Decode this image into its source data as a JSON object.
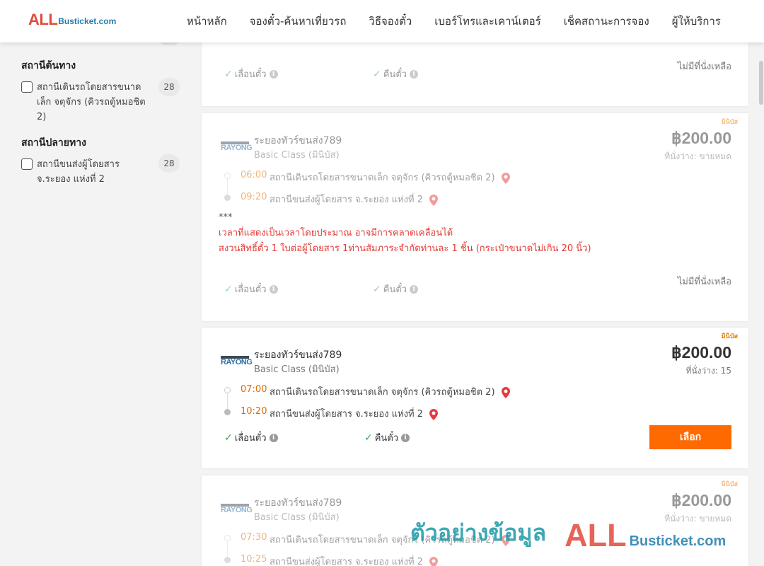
{
  "brand": {
    "logo_all": "ALL",
    "logo_rest": "Busticket.com"
  },
  "nav": [
    {
      "label": "หน้าหลัก"
    },
    {
      "label": "จองตั๋ว-ค้นหาเที่ยวรถ"
    },
    {
      "label": "วิธีจองตั๋ว"
    },
    {
      "label": "เบอร์โทรและเคาน์เตอร์"
    },
    {
      "label": "เช็คสถานะการจอง"
    },
    {
      "label": "ผู้ให้บริการ"
    }
  ],
  "sidebar": {
    "origin": {
      "title": "สถานีต้นทาง",
      "label": "สถานีเดินรถโดยสารขนาดเล็ก จตุจักร (คิวรถตู้หมอชิต 2)",
      "count": "28"
    },
    "destination": {
      "title": "สถานีปลายทาง",
      "label": "สถานีขนส่งผู้โดยสาร จ.ระยอง แห่งที่ 2",
      "count": "28"
    }
  },
  "common": {
    "badge": "มินิบัส",
    "reschedule": "เลื่อนตั๋ว",
    "refund": "คืนตั๋ว",
    "no_seats": "ไม่มีที่นั่งเหลือ",
    "select": "เลือก",
    "operator_logo_text": "RAYONG",
    "stop_from": "สถานีเดินรถโดยสารขนาดเล็ก จตุจักร (คิวรถตู้หมอชิต 2)",
    "stop_to": "สถานีขนส่งผู้โดยสาร จ.ระยอง แห่งที่ 2"
  },
  "trips": [
    {
      "operator": "ระยองทัวร์ขนส่ง789",
      "class": "Basic Class (มินิบัส)",
      "price": "฿200.00",
      "seats": "ที่นั่งว่าง: ขายหมด",
      "depart": "06:00",
      "arrive": "09:20",
      "note_stars": "***",
      "note_1": "เวลาที่แสดงเป็นเวลาโดยประมาณ อาจมีการคลาดเคลื่อนได้",
      "note_2": "สงวนสิทธิ์ตั๋ว 1 ใบต่อผู้โดยสาร 1ท่านสัมภาระจำกัดท่านละ 1 ชิ้น (กระเป๋าขนาดไม่เกิน 20 นิ้ว)"
    },
    {
      "operator": "ระยองทัวร์ขนส่ง789",
      "class": "Basic Class (มินิบัส)",
      "price": "฿200.00",
      "seats": "ที่นั่งว่าง: 15",
      "depart": "07:00",
      "arrive": "10:20"
    },
    {
      "operator": "ระยองทัวร์ขนส่ง789",
      "class": "Basic Class (มินิบัส)",
      "price": "฿200.00",
      "seats": "ที่นั่งว่าง: ขายหมด",
      "depart": "07:30",
      "arrive": "10:25"
    }
  ],
  "watermark": {
    "text": "ตัวอย่างข้อมูล",
    "all": "ALL",
    "rest": "Busticket.com"
  },
  "colors": {
    "accent": "#ff6a00",
    "time": "#e06c00",
    "note_red": "#e53935",
    "check_green": "#3fa34d"
  }
}
